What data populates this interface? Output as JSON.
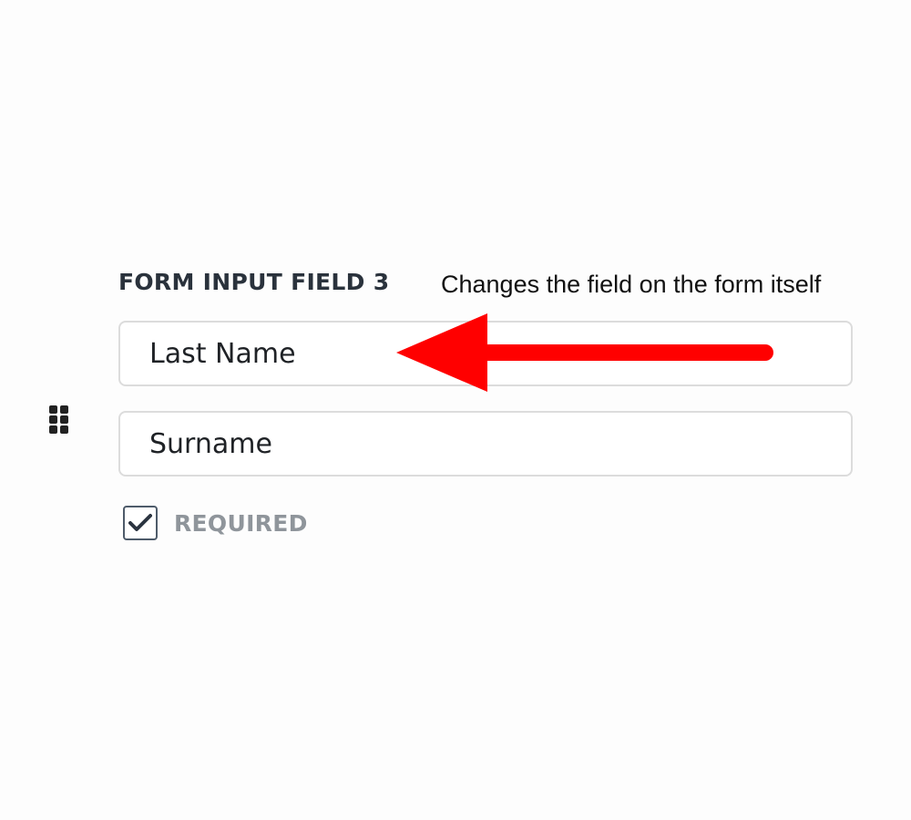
{
  "field": {
    "label": "FORM INPUT FIELD 3",
    "primary_value": "Last Name",
    "secondary_value": "Surname",
    "required_label": "REQUIRED",
    "required_checked": true
  },
  "annotation": {
    "text": "Changes the field on the form itself",
    "arrow_color": "#ff0000"
  },
  "icons": {
    "drag_handle": "drag-handle-icon",
    "checkbox_mark": "check-icon"
  }
}
